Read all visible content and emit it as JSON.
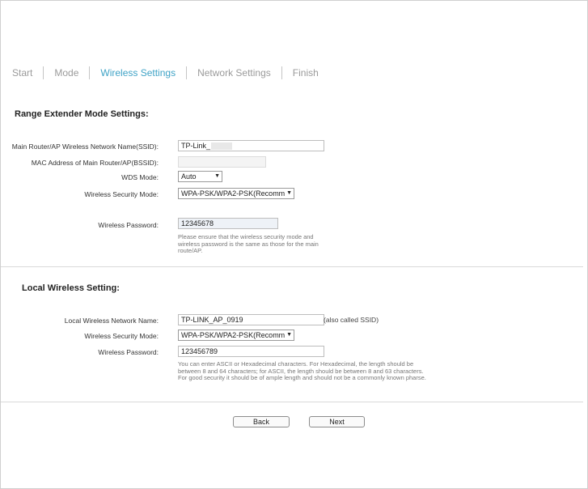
{
  "steps": [
    "Start",
    "Mode",
    "Wireless Settings",
    "Network Settings",
    "Finish"
  ],
  "active_step": 2,
  "range_extender": {
    "title": "Range Extender Mode Settings:",
    "ssid_label": "Main Router/AP Wireless Network Name(SSID):",
    "ssid_value": "TP-Link_",
    "mac_label": "MAC Address of Main Router/AP(BSSID):",
    "mac_value": "",
    "wds_label": "WDS Mode:",
    "wds_value": "Auto",
    "security_label": "Wireless Security Mode:",
    "security_value": "WPA-PSK/WPA2-PSK(Recomm",
    "password_label": "Wireless Password:",
    "password_value": "12345678",
    "password_hint": "Please ensure that the wireless security mode and wireless password is the same as those for the main route/AP."
  },
  "local": {
    "title": "Local Wireless Setting:",
    "name_label": "Local Wireless Network Name:",
    "name_value": "TP-LINK_AP_0919",
    "name_note": "(also called SSID)",
    "security_label": "Wireless Security Mode:",
    "security_value": "WPA-PSK/WPA2-PSK(Recomm",
    "password_label": "Wireless Password:",
    "password_value": "123456789",
    "password_hint": "You can enter ASCII or Hexadecimal characters. For Hexadecimal, the length should be between 8 and 64 characters; for ASCII, the length should be between 8 and 63 characters. For good security it should be of ample length and should not be a commonly known pharse."
  },
  "buttons": {
    "back": "Back",
    "next": "Next"
  },
  "colors": {
    "active_step": "#3fa3c6",
    "inactive_step": "#9b9b9b"
  },
  "icons": {
    "dropdown": "chevron-down-icon"
  }
}
